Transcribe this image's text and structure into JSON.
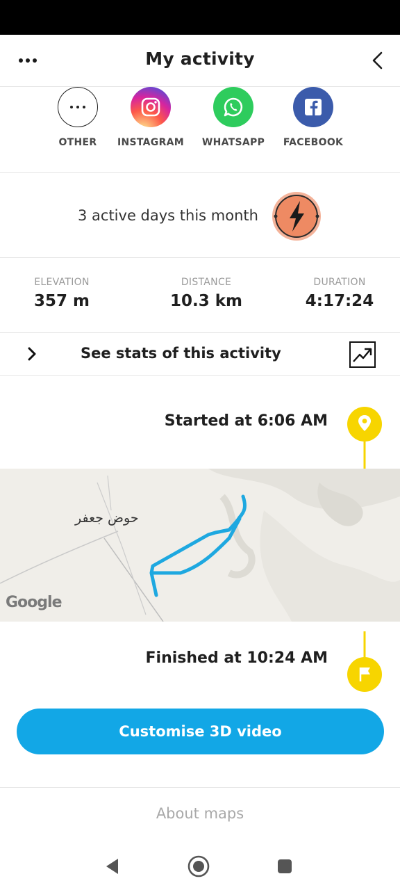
{
  "header": {
    "title": "My activity",
    "menu_icon": "more-horizontal-icon",
    "back_icon": "chevron-left-icon"
  },
  "share": {
    "items": [
      {
        "label": "OTHER",
        "icon": "more-icon"
      },
      {
        "label": "INSTAGRAM",
        "icon": "instagram-icon"
      },
      {
        "label": "WHATSAPP",
        "icon": "whatsapp-icon"
      },
      {
        "label": "FACEBOOK",
        "icon": "facebook-icon"
      }
    ]
  },
  "active_days": {
    "text": "3 active days this month",
    "badge_icon": "lightning-badge-icon"
  },
  "stats": [
    {
      "label": "ELEVATION",
      "value": "357 m"
    },
    {
      "label": "DISTANCE",
      "value": "10.3 km"
    },
    {
      "label": "DURATION",
      "value": "4:17:24"
    }
  ],
  "see_stats": {
    "label": "See stats of this activity",
    "icon": "trending-up-icon"
  },
  "started": {
    "text": "Started at 6:06 AM",
    "icon": "map-pin-icon"
  },
  "map": {
    "place_label": "حوض جعفر",
    "attribution": "Google"
  },
  "finished": {
    "text": "Finished at 10:24 AM",
    "icon": "flag-icon"
  },
  "cta": {
    "label": "Customise 3D video"
  },
  "about_maps": "About maps",
  "colors": {
    "accent_blue": "#12a7e6",
    "pin_yellow": "#f7d500",
    "badge_orange": "#f08a5d",
    "track_blue": "#1ea8e0"
  }
}
